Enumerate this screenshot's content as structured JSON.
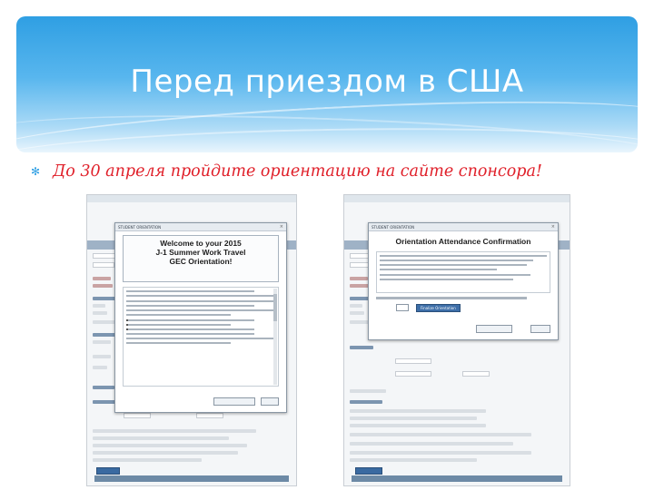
{
  "slide": {
    "title": "Перед приездом в США",
    "bullet": "До 30 апреля пройдите ориентацию на сайте спонсора!"
  },
  "left_screenshot": {
    "modal_header": "STUDENT ORIENTATION",
    "welcome_title": "Welcome to your 2015",
    "welcome_sub1": "J-1 Summer Work Travel",
    "welcome_sub2": "GEC Orientation!"
  },
  "right_screenshot": {
    "modal_header": "STUDENT ORIENTATION",
    "oac_title": "Orientation Attendance Confirmation",
    "finalize_label": "Finalize Orientation"
  }
}
